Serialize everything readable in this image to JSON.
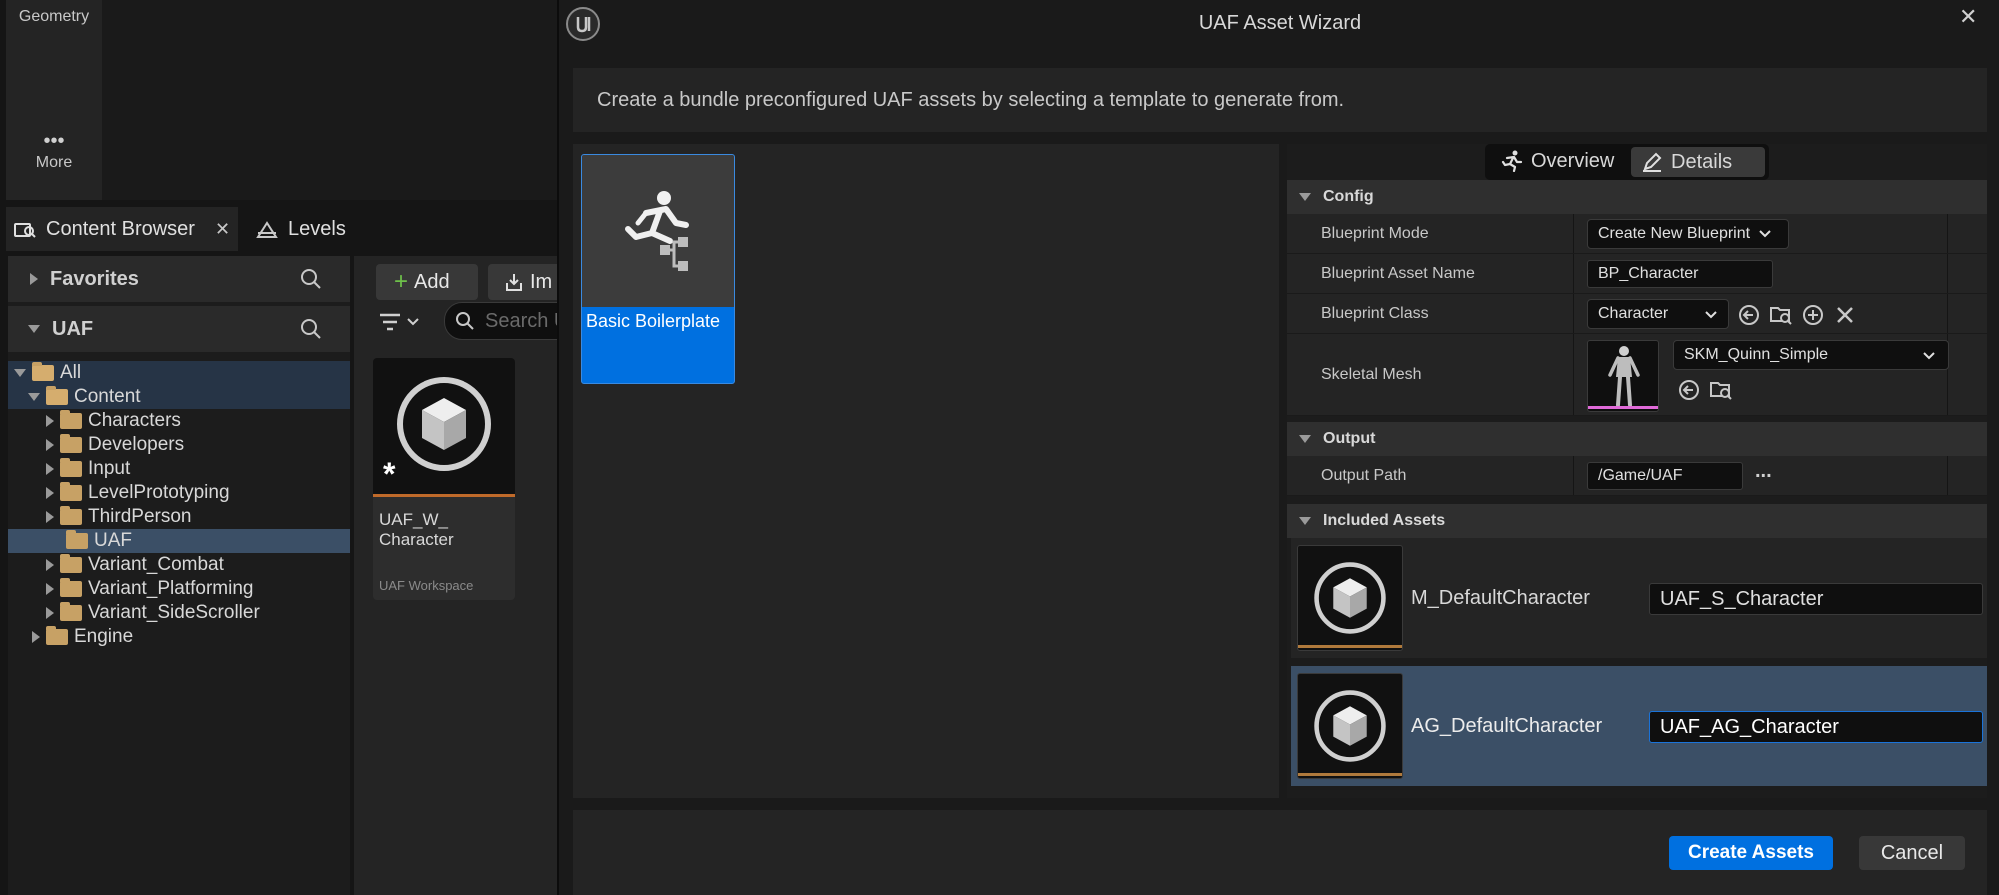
{
  "toolrail": {
    "geometry_label": "Geometry",
    "more_label": "More"
  },
  "content_browser": {
    "tab_label": "Content Browser",
    "levels_tab_label": "Levels",
    "favorites_label": "Favorites",
    "uaf_section_label": "UAF",
    "tree": [
      "All",
      "Content",
      "Characters",
      "Developers",
      "Input",
      "LevelPrototyping",
      "ThirdPerson",
      "UAF",
      "Variant_Combat",
      "Variant_Platforming",
      "Variant_SideScroller",
      "Engine"
    ],
    "add_button": "Add",
    "import_button": "Im",
    "search_placeholder": "Search U",
    "asset": {
      "name": "UAF_W_ Character",
      "type": "UAF Workspace"
    }
  },
  "dialog": {
    "title": "UAF Asset Wizard",
    "description": "Create a bundle preconfigured UAF assets by selecting a template to generate from.",
    "template_name": "Basic Boilerplate",
    "tabs": {
      "overview": "Overview",
      "details": "Details"
    },
    "config": {
      "header": "Config",
      "blueprint_mode_label": "Blueprint Mode",
      "blueprint_mode_value": "Create New Blueprint",
      "blueprint_asset_name_label": "Blueprint Asset Name",
      "blueprint_asset_name_value": "BP_Character",
      "blueprint_class_label": "Blueprint Class",
      "blueprint_class_value": "Character",
      "skeletal_mesh_label": "Skeletal Mesh",
      "skeletal_mesh_value": "SKM_Quinn_Simple"
    },
    "output": {
      "header": "Output",
      "output_path_label": "Output Path",
      "output_path_value": "/Game/UAF",
      "more_dots": "..."
    },
    "included_assets": {
      "header": "Included Assets",
      "items": [
        {
          "name": "M_DefaultCharacter",
          "value": "UAF_S_Character"
        },
        {
          "name": "AG_DefaultCharacter",
          "value": "UAF_AG_Character"
        }
      ]
    },
    "create_button": "Create Assets",
    "cancel_button": "Cancel"
  }
}
